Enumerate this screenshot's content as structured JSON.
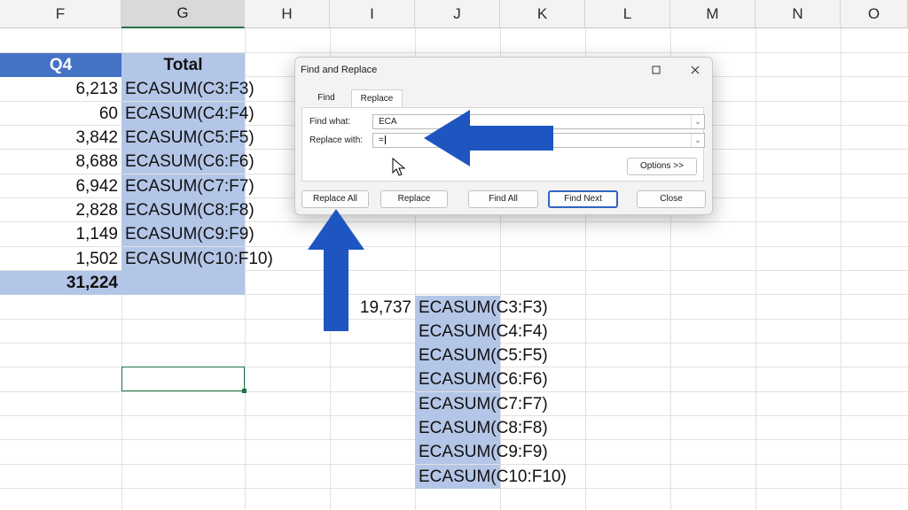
{
  "columns": [
    "F",
    "G",
    "H",
    "I",
    "J",
    "K",
    "L",
    "M",
    "N",
    "O"
  ],
  "selected_column": "G",
  "table": {
    "header_q4": "Q4",
    "header_total": "Total",
    "q4_values": [
      "6,213",
      "60",
      "3,842",
      "8,688",
      "6,942",
      "2,828",
      "1,149",
      "1,502"
    ],
    "total_formulas": [
      "ECASUM(C3:F3)",
      "ECASUM(C4:F4)",
      "ECASUM(C5:F5)",
      "ECASUM(C6:F6)",
      "ECASUM(C7:F7)",
      "ECASUM(C8:F8)",
      "ECASUM(C9:F9)",
      "ECASUM(C10:F10)"
    ],
    "grand_total": "31,224"
  },
  "side_block": {
    "value": "19,737",
    "formulas": [
      "ECASUM(C3:F3)",
      "ECASUM(C4:F4)",
      "ECASUM(C5:F5)",
      "ECASUM(C6:F6)",
      "ECASUM(C7:F7)",
      "ECASUM(C8:F8)",
      "ECASUM(C9:F9)",
      "ECASUM(C10:F10)"
    ]
  },
  "dialog": {
    "title": "Find and Replace",
    "tabs": [
      "Find",
      "Replace"
    ],
    "active_tab": "Replace",
    "find_label": "Find what:",
    "find_value": "ECA",
    "replace_label": "Replace with:",
    "replace_value": "=",
    "options_label": "Options >>",
    "buttons": {
      "replace_all": "Replace All",
      "replace": "Replace",
      "find_all": "Find All",
      "find_next": "Find Next",
      "close": "Close"
    }
  },
  "colors": {
    "accent_blue": "#4472c4",
    "light_blue": "#b4c6e7",
    "arrow_blue": "#1f55c0",
    "excel_green": "#217346"
  }
}
